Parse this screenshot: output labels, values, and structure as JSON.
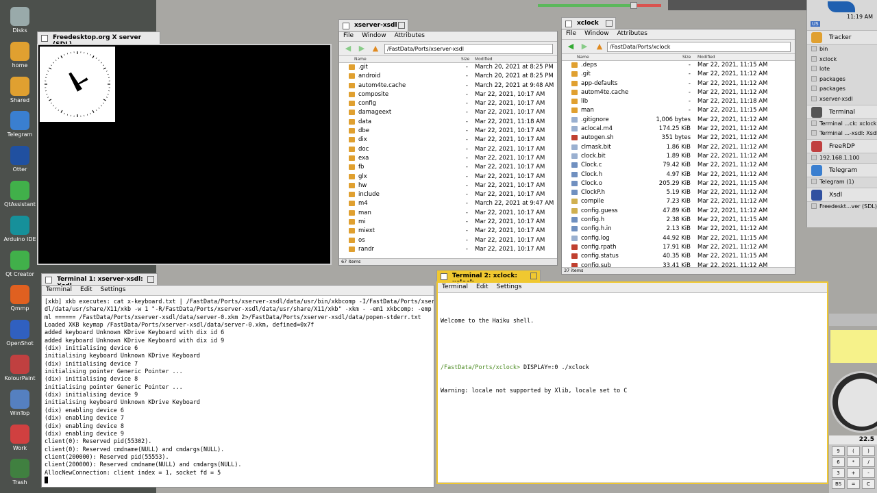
{
  "desktop_icons": [
    "Disks",
    "home",
    "Shared",
    "Telegram",
    "Otter",
    "QtAssistant",
    "Arduino IDE",
    "Qt Creator",
    "Qmmp",
    "OpenShot",
    "KolourPaint",
    "WinTop",
    "Work",
    "Trash"
  ],
  "sdl_window": {
    "title": "Freedesktop.org X server (SDL)"
  },
  "fm1": {
    "title": "xserver-xsdl",
    "menu": [
      "File",
      "Window",
      "Attributes"
    ],
    "path": "/FastData/Ports/xserver-xsdl",
    "cols": [
      "Name",
      "Size",
      "Modified"
    ],
    "status": "67 items",
    "rows": [
      {
        "name": ".git",
        "size": "-",
        "mod": "March 20, 2021 at 8:25 PM"
      },
      {
        "name": "android",
        "size": "-",
        "mod": "March 20, 2021 at 8:25 PM"
      },
      {
        "name": "autom4te.cache",
        "size": "-",
        "mod": "March 22, 2021 at 9:48 AM"
      },
      {
        "name": "composite",
        "size": "-",
        "mod": "Mar 22, 2021, 10:17 AM"
      },
      {
        "name": "config",
        "size": "-",
        "mod": "Mar 22, 2021, 10:17 AM"
      },
      {
        "name": "damageext",
        "size": "-",
        "mod": "Mar 22, 2021, 10:17 AM"
      },
      {
        "name": "data",
        "size": "-",
        "mod": "Mar 22, 2021, 11:18 AM"
      },
      {
        "name": "dbe",
        "size": "-",
        "mod": "Mar 22, 2021, 10:17 AM"
      },
      {
        "name": "dix",
        "size": "-",
        "mod": "Mar 22, 2021, 10:17 AM"
      },
      {
        "name": "doc",
        "size": "-",
        "mod": "Mar 22, 2021, 10:17 AM"
      },
      {
        "name": "exa",
        "size": "-",
        "mod": "Mar 22, 2021, 10:17 AM"
      },
      {
        "name": "fb",
        "size": "-",
        "mod": "Mar 22, 2021, 10:17 AM"
      },
      {
        "name": "glx",
        "size": "-",
        "mod": "Mar 22, 2021, 10:17 AM"
      },
      {
        "name": "hw",
        "size": "-",
        "mod": "Mar 22, 2021, 10:17 AM"
      },
      {
        "name": "include",
        "size": "-",
        "mod": "Mar 22, 2021, 10:17 AM"
      },
      {
        "name": "m4",
        "size": "-",
        "mod": "March 22, 2021 at 9:47 AM"
      },
      {
        "name": "man",
        "size": "-",
        "mod": "Mar 22, 2021, 10:17 AM"
      },
      {
        "name": "mi",
        "size": "-",
        "mod": "Mar 22, 2021, 10:17 AM"
      },
      {
        "name": "miext",
        "size": "-",
        "mod": "Mar 22, 2021, 10:17 AM"
      },
      {
        "name": "os",
        "size": "-",
        "mod": "Mar 22, 2021, 10:17 AM"
      },
      {
        "name": "randr",
        "size": "-",
        "mod": "Mar 22, 2021, 10:17 AM"
      }
    ]
  },
  "fm2": {
    "title": "xclock",
    "menu": [
      "File",
      "Window",
      "Attributes"
    ],
    "path": "/FastData/Ports/xclock",
    "cols": [
      "Name",
      "Size",
      "Modified"
    ],
    "status": "37 items",
    "rows": [
      {
        "name": ".deps",
        "size": "-",
        "mod": "Mar 22, 2021, 11:15 AM",
        "c": "#e0a030"
      },
      {
        "name": ".git",
        "size": "-",
        "mod": "Mar 22, 2021, 11:12 AM",
        "c": "#e0a030"
      },
      {
        "name": "app-defaults",
        "size": "-",
        "mod": "Mar 22, 2021, 11:12 AM",
        "c": "#e0a030"
      },
      {
        "name": "autom4te.cache",
        "size": "-",
        "mod": "Mar 22, 2021, 11:12 AM",
        "c": "#e0a030"
      },
      {
        "name": "lib",
        "size": "-",
        "mod": "Mar 22, 2021, 11:18 AM",
        "c": "#e0a030"
      },
      {
        "name": "man",
        "size": "-",
        "mod": "Mar 22, 2021, 11:15 AM",
        "c": "#e0a030"
      },
      {
        "name": ".gitignore",
        "size": "1,006 bytes",
        "mod": "Mar 22, 2021, 11:12 AM",
        "c": "#9ab0d0"
      },
      {
        "name": "aclocal.m4",
        "size": "174.25 KiB",
        "mod": "Mar 22, 2021, 11:12 AM",
        "c": "#9ab0d0"
      },
      {
        "name": "autogen.sh",
        "size": "351 bytes",
        "mod": "Mar 22, 2021, 11:12 AM",
        "c": "#c04030"
      },
      {
        "name": "clmask.bit",
        "size": "1.86 KiB",
        "mod": "Mar 22, 2021, 11:12 AM",
        "c": "#9ab0d0"
      },
      {
        "name": "clock.bit",
        "size": "1.89 KiB",
        "mod": "Mar 22, 2021, 11:12 AM",
        "c": "#9ab0d0"
      },
      {
        "name": "Clock.c",
        "size": "79.42 KiB",
        "mod": "Mar 22, 2021, 11:12 AM",
        "c": "#7090c0"
      },
      {
        "name": "Clock.h",
        "size": "4.97 KiB",
        "mod": "Mar 22, 2021, 11:12 AM",
        "c": "#7090c0"
      },
      {
        "name": "Clock.o",
        "size": "205.29 KiB",
        "mod": "Mar 22, 2021, 11:15 AM",
        "c": "#7090c0"
      },
      {
        "name": "ClockP.h",
        "size": "5.19 KiB",
        "mod": "Mar 22, 2021, 11:12 AM",
        "c": "#7090c0"
      },
      {
        "name": "compile",
        "size": "7.23 KiB",
        "mod": "Mar 22, 2021, 11:12 AM",
        "c": "#d0b050"
      },
      {
        "name": "config.guess",
        "size": "47.89 KiB",
        "mod": "Mar 22, 2021, 11:12 AM",
        "c": "#d0b050"
      },
      {
        "name": "config.h",
        "size": "2.38 KiB",
        "mod": "Mar 22, 2021, 11:15 AM",
        "c": "#7090c0"
      },
      {
        "name": "config.h.in",
        "size": "2.13 KiB",
        "mod": "Mar 22, 2021, 11:12 AM",
        "c": "#7090c0"
      },
      {
        "name": "config.log",
        "size": "44.92 KiB",
        "mod": "Mar 22, 2021, 11:15 AM",
        "c": "#9ab0d0"
      },
      {
        "name": "config.rpath",
        "size": "17.91 KiB",
        "mod": "Mar 22, 2021, 11:12 AM",
        "c": "#c04030"
      },
      {
        "name": "config.status",
        "size": "40.35 KiB",
        "mod": "Mar 22, 2021, 11:15 AM",
        "c": "#c04030"
      },
      {
        "name": "config.sub",
        "size": "33.41 KiB",
        "mod": "Mar 22, 2021, 11:12 AM",
        "c": "#c04030"
      }
    ]
  },
  "term1": {
    "title": "Terminal 1: xserver-xsdl: Xsdl",
    "menu": [
      "Terminal",
      "Edit",
      "Settings"
    ],
    "lines": [
      "[xkb] xkb executes: cat x-keyboard.txt | /FastData/Ports/xserver-xsdl/data/usr/bin/xkbcomp -I/FastData/Ports/xserver-xs",
      "dl/data/usr/share/X11/xkb -w 1 \"-R/FastData/Ports/xserver-xsdl/data/usr/share/X11/xkb\" -xkm - -em1 xkbcomp: -emp --- -e",
      "ml ====== /FastData/Ports/xserver-xsdl/data/server-0.xkm 2>/FastData/Ports/xserver-xsdl/data/popen-stderr.txt",
      "Loaded XKB keymap /FastData/Ports/xserver-xsdl/data/server-0.xkm, defined=0x7f",
      "added keyboard Unknown KDrive Keyboard with dix id 6",
      "added keyboard Unknown KDrive Keyboard with dix id 9",
      "(dix) initialising device 6",
      "initialising keyboard Unknown KDrive Keyboard",
      "(dix) initialising device 7",
      "initialising pointer Generic Pointer ...",
      "(dix) initialising device 8",
      "initialising pointer Generic Pointer ...",
      "(dix) initialising device 9",
      "initialising keyboard Unknown KDrive Keyboard",
      "(dix) enabling device 6",
      "(dix) enabling device 7",
      "(dix) enabling device 8",
      "(dix) enabling device 9",
      "client(0): Reserved pid(55302).",
      "client(0): Reserved cmdname(NULL) and cmdargs(NULL).",
      "client(200000): Reserved pid(55553).",
      "client(200000): Reserved cmdname(NULL) and cmdargs(NULL).",
      "AllocNewConnection: client index = 1, socket fd = 5"
    ]
  },
  "term2": {
    "title": "Terminal 2: xclock: xclock",
    "menu": [
      "Terminal",
      "Edit",
      "Settings"
    ],
    "welcome": "Welcome to the Haiku shell.",
    "prompt": "/FastData/Ports/xclock>",
    "command": " DISPLAY=:0 ./xclock",
    "warning": "Warning: locale not supported by Xlib, locale set to C"
  },
  "deskbar": {
    "time": "11:19 AM",
    "lang": "US",
    "apps": [
      {
        "name": "Tracker",
        "items": [
          "bin",
          "xclock",
          "lote",
          "packages",
          "packages",
          "xserver-xsdl"
        ]
      },
      {
        "name": "Terminal",
        "items": [
          "Terminal ...ck: xclock",
          "Terminal ...-xsdl: Xsdl"
        ]
      },
      {
        "name": "FreeRDP",
        "items": [
          "192.168.1.100"
        ]
      },
      {
        "name": "Telegram",
        "items": [
          "Telegram (1)"
        ]
      },
      {
        "name": "Xsdl",
        "items": [
          "Freedeskt...ver (SDL)"
        ]
      }
    ]
  },
  "calc": {
    "display": "22.5",
    "keys": [
      "9",
      "(",
      ")",
      "6",
      "*",
      "/",
      "3",
      "+",
      "-",
      "BS",
      "=",
      "C"
    ]
  },
  "colors": {
    "accent_yellow": "#f0c830",
    "term_prompt": "#4a8a20"
  }
}
